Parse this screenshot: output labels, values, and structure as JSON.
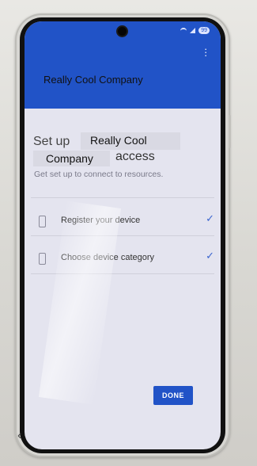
{
  "header": {
    "company_name": "Really Cool Company",
    "battery_text": "99"
  },
  "main": {
    "title_prefix": "Set up",
    "title_company_line1": "Really Cool",
    "title_company_line2": "Company",
    "title_suffix": "access",
    "subtitle": "Get set up to connect to resources.",
    "steps": [
      {
        "label": "Register your device",
        "icon": "smartphone-icon",
        "status_icon": "checkmark-icon"
      },
      {
        "label": "Choose device category",
        "icon": "smartphone-icon",
        "status_icon": "checkmark-icon"
      }
    ],
    "done_label": "DONE"
  },
  "colors": {
    "header_bg": "#2153c7",
    "accent": "#2153c7",
    "check": "#3c66cf",
    "screen_bg": "#e4e4ef"
  }
}
